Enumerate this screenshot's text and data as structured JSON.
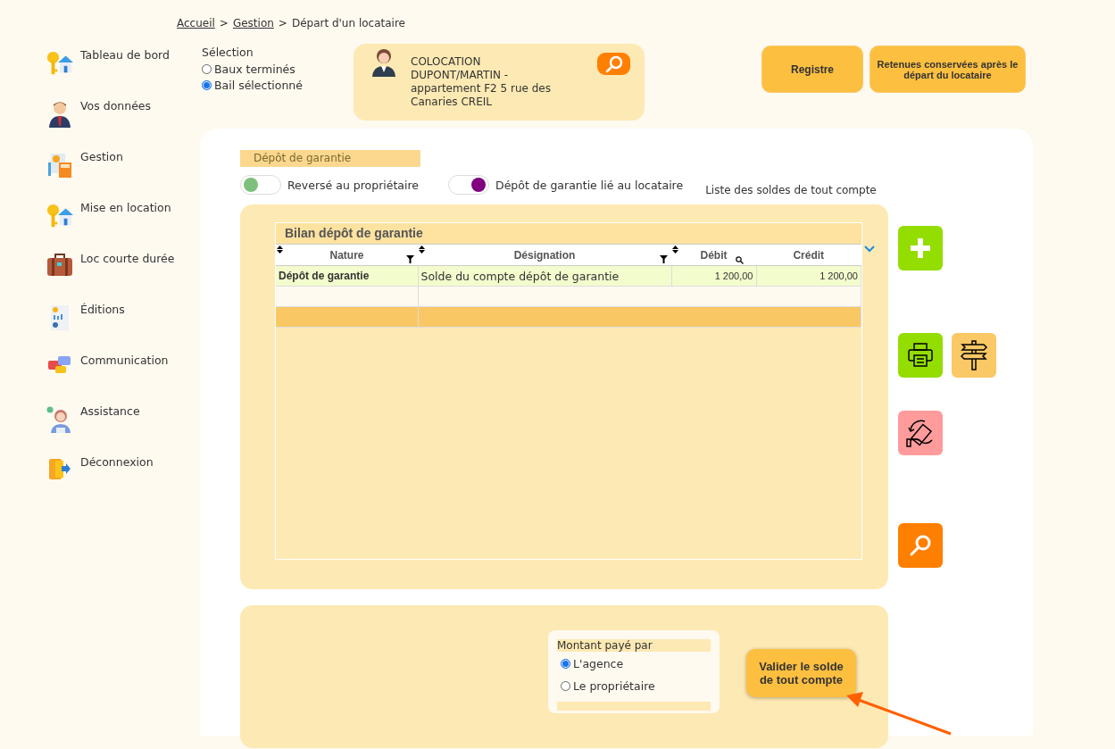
{
  "breadcrumb": [
    {
      "label": "Accueil",
      "link": true
    },
    {
      "label": "Gestion",
      "link": true
    },
    {
      "label": "Départ d'un locataire",
      "link": false
    }
  ],
  "breadcrumb_separator": ">",
  "sidebar": {
    "items": [
      {
        "label": "Tableau de bord",
        "kind": "keys"
      },
      {
        "label": "Vos données",
        "kind": "person"
      },
      {
        "label": "Gestion",
        "kind": "calculator"
      },
      {
        "label": "Mise en location",
        "kind": "keys"
      },
      {
        "label": "Loc courte durée",
        "kind": "suitcase"
      },
      {
        "label": "Éditions",
        "kind": "report"
      },
      {
        "label": "Communication",
        "kind": "chat"
      },
      {
        "label": "Assistance",
        "kind": "support"
      },
      {
        "label": "Déconnexion",
        "kind": "exit"
      }
    ]
  },
  "selection": {
    "title": "Sélection",
    "options": [
      {
        "label": "Baux terminés",
        "selected": false
      },
      {
        "label": "Bail sélectionné",
        "selected": true
      }
    ]
  },
  "tenant_card": {
    "text": "COLOCATION DUPONT/MARTIN - appartement F2 5 rue des Canaries CREIL"
  },
  "top_buttons": [
    "Registre",
    "Retenues conservées après le départ du locataire"
  ],
  "section_title": "Dépôt de garantie",
  "toggles": [
    {
      "label": "Reversé au propriétaire",
      "on": false
    },
    {
      "label": "Dépôt de garantie lié au locataire",
      "on": true
    }
  ],
  "list_label": "Liste des soldes de tout compte",
  "table": {
    "title": "Bilan dépôt de garantie",
    "columns": [
      {
        "label": "Nature",
        "sortable": true,
        "filter": true,
        "search": false
      },
      {
        "label": "Désignation",
        "sortable": true,
        "filter": true,
        "search": false
      },
      {
        "label": "Débit",
        "sortable": true,
        "filter": false,
        "search": true
      },
      {
        "label": "Crédit",
        "sortable": false,
        "filter": false,
        "search": false
      }
    ],
    "rows": [
      {
        "cells": [
          "Dépôt de garantie",
          "Solde du compte dépôt de garantie",
          "1 200,00",
          "1 200,00"
        ],
        "selected": true
      }
    ]
  },
  "actions": [
    {
      "kind": "add"
    },
    {
      "kind": "print"
    },
    {
      "kind": "signpost"
    },
    {
      "kind": "refund"
    },
    {
      "kind": "search"
    }
  ],
  "payment": {
    "title": "Montant payé par",
    "options": [
      {
        "label": "L'agence",
        "selected": true
      },
      {
        "label": "Le propriétaire",
        "selected": false
      }
    ]
  },
  "validate_button": "Valider le solde de tout compte"
}
